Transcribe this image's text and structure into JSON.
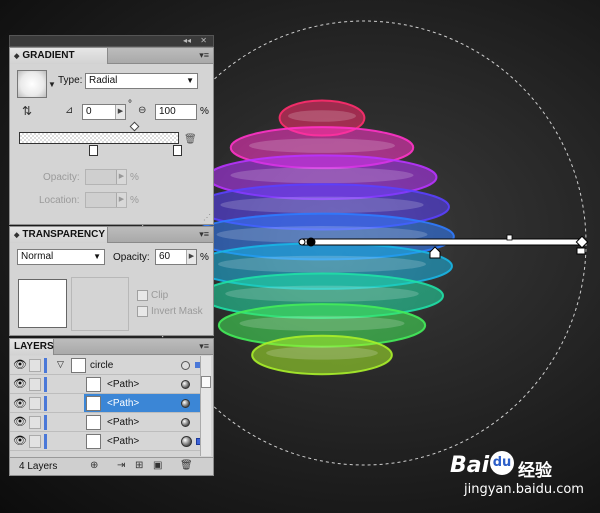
{
  "canvas": {
    "background": "#222222",
    "sphere_colors": [
      "#ff2d6e",
      "#ff33c8",
      "#b833ff",
      "#5a40ff",
      "#2f7bff",
      "#18b6e6",
      "#1fe0a6",
      "#44ec5a",
      "#a8f02a"
    ]
  },
  "gradient_panel": {
    "title": "GRADIENT",
    "type_label": "Type:",
    "type_value": "Radial",
    "angle_value": "0",
    "angle_unit": "°",
    "aspect_value": "100",
    "aspect_unit": "%",
    "opacity_label": "Opacity:",
    "opacity_unit": "%",
    "location_label": "Location:",
    "location_unit": "%"
  },
  "transparency_panel": {
    "title": "TRANSPARENCY",
    "blend_mode": "Normal",
    "opacity_label": "Opacity:",
    "opacity_value": "60",
    "opacity_unit": "%",
    "clip_label": "Clip",
    "invert_label": "Invert Mask"
  },
  "layers_panel": {
    "title": "LAYERS",
    "layer_name": "circle",
    "rows": [
      {
        "name": "<Path>",
        "selected": false
      },
      {
        "name": "<Path>",
        "selected": true
      },
      {
        "name": "<Path>",
        "selected": false
      },
      {
        "name": "<Path>",
        "selected": false
      }
    ],
    "footer_count": "4 Layers"
  },
  "watermark": {
    "logo_text": "Bai",
    "logo_suffix": "经验",
    "url": "jingyan.baidu.com",
    "du_text": "du"
  },
  "icons": [
    "collapse-icon",
    "close-icon",
    "panel-menu-icon",
    "reverse-gradient-icon",
    "angle-icon",
    "aspect-ratio-icon",
    "delete-stop-icon",
    "eye-icon",
    "target-icon",
    "new-layer-icon",
    "trash-icon"
  ]
}
